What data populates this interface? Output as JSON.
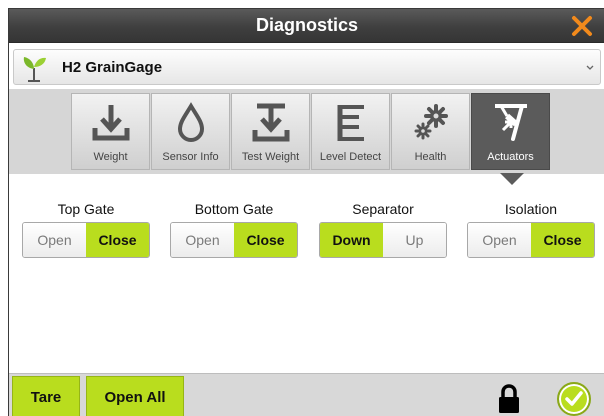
{
  "window": {
    "title": "Diagnostics"
  },
  "device": {
    "name": "H2 GrainGage"
  },
  "tabs": [
    {
      "label": "Weight",
      "icon": "weight-icon"
    },
    {
      "label": "Sensor Info",
      "icon": "drop-icon"
    },
    {
      "label": "Test Weight",
      "icon": "test-weight-icon"
    },
    {
      "label": "Level Detect",
      "icon": "level-detect-icon"
    },
    {
      "label": "Health",
      "icon": "gears-icon"
    },
    {
      "label": "Actuators",
      "icon": "actuator-icon",
      "active": true
    }
  ],
  "controls": [
    {
      "label": "Top Gate",
      "options": [
        "Open",
        "Close"
      ],
      "selected": "Close"
    },
    {
      "label": "Bottom Gate",
      "options": [
        "Open",
        "Close"
      ],
      "selected": "Close"
    },
    {
      "label": "Separator",
      "options": [
        "Down",
        "Up"
      ],
      "selected": "Down"
    },
    {
      "label": "Isolation",
      "options": [
        "Open",
        "Close"
      ],
      "selected": "Close"
    }
  ],
  "bottom": {
    "tare_label": "Tare",
    "open_all_label": "Open All"
  },
  "colors": {
    "accent": "#b9dd1e",
    "close_x": "#f28a1c",
    "titlebar": "#3f3f3f"
  }
}
